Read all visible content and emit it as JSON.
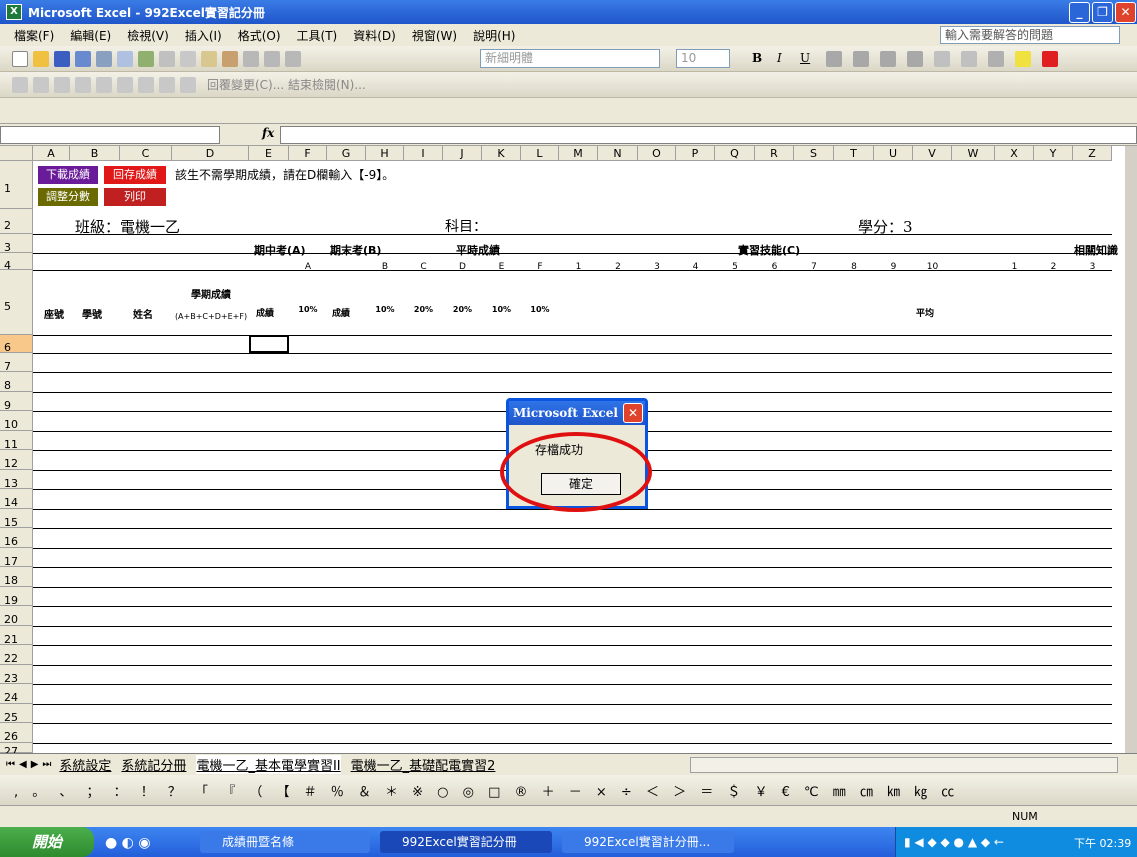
{
  "window": {
    "title": "Microsoft Excel - 992Excel實習記分冊"
  },
  "menu": {
    "items": [
      "檔案(F)",
      "編輯(E)",
      "檢視(V)",
      "插入(I)",
      "格式(O)",
      "工具(T)",
      "資料(D)",
      "視窗(W)",
      "說明(H)"
    ],
    "help_box": "輸入需要解答的問題"
  },
  "toolbar": {
    "font": "新細明體",
    "size": "10",
    "bold": "B",
    "italic": "I",
    "underline": "U",
    "review": "回覆變更(C)... 結束檢閱(N)..."
  },
  "formula": {
    "fx": "fx"
  },
  "columns": [
    "A",
    "B",
    "C",
    "D",
    "E",
    "F",
    "G",
    "H",
    "I",
    "J",
    "K",
    "L",
    "M",
    "N",
    "O",
    "P",
    "Q",
    "R",
    "S",
    "T",
    "U",
    "V",
    "W",
    "X",
    "Y",
    "Z"
  ],
  "sheet": {
    "btn_download": "下載成績",
    "btn_save": "回存成績",
    "btn_adjust": "調整分數",
    "btn_print": "列印",
    "note": "該生不需學期成績，請在D欄輸入【-9】。",
    "class_label": "班級：電機一乙",
    "subject_label": "科目：",
    "credit_label": "學分：3",
    "h_midterm": "期中考(A)",
    "h_final": "期末考(B)",
    "h_usual": "平時成績",
    "h_skill": "實習技能(C)",
    "h_related": "相關知識",
    "h_seat": "座號",
    "h_id": "學號",
    "h_name": "姓名",
    "h_term": "學期成績",
    "h_formula": "(A+B+C+D+E+F)",
    "h_score": "成績",
    "h_avg": "平均",
    "sub_letters": [
      "A",
      "B",
      "C",
      "D",
      "E",
      "F"
    ],
    "pct": [
      "10%",
      "10%",
      "20%",
      "20%",
      "10%",
      "10%"
    ],
    "skill_nums": [
      "1",
      "2",
      "3",
      "4",
      "5",
      "6",
      "7",
      "8",
      "9",
      "10"
    ],
    "related_nums": [
      "1",
      "2",
      "3"
    ]
  },
  "rows": [
    "1",
    "2",
    "3",
    "4",
    "5",
    "6",
    "7",
    "8",
    "9",
    "10",
    "11",
    "12",
    "13",
    "14",
    "15",
    "16",
    "17",
    "18",
    "19",
    "20",
    "21",
    "22",
    "23",
    "24",
    "25",
    "26",
    "27"
  ],
  "sheet_tabs": [
    "系統設定",
    "系統記分冊",
    "電機一乙_基本電學實習II",
    "電機一乙_基礎配電實習2"
  ],
  "symbols": ", 。 、 ； ： ！ ？ 「 『 （ 【 ＃ ％ ＆ ＊ ※ ○ ◎ □ ® ＋ － × ÷ ＜ ＞ ＝ ＄ ￥ € ℃ ㎜ ㎝ ㎞ ㎏ ㏄",
  "status": {
    "num": "NUM"
  },
  "dialog": {
    "title": "Microsoft Excel",
    "message": "存檔成功",
    "ok": "確定"
  },
  "taskbar": {
    "start": "開始",
    "items": [
      "成績冊暨名條",
      "992Excel實習記分冊",
      "992Excel實習計分冊..."
    ],
    "clock": "下午 02:39"
  }
}
